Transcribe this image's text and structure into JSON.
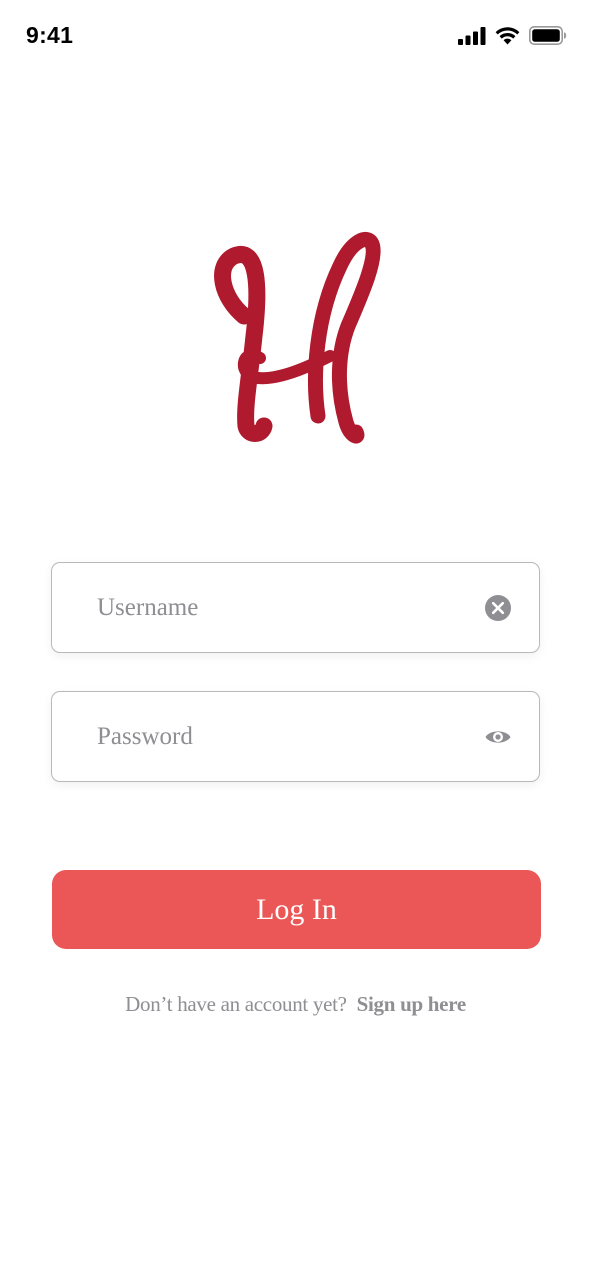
{
  "status_bar": {
    "time": "9:41",
    "icons": [
      "signal-icon",
      "wifi-icon",
      "battery-icon"
    ]
  },
  "logo": {
    "letter": "H",
    "color": "#b01a2e"
  },
  "form": {
    "username": {
      "placeholder": "Username",
      "value": "",
      "icon": "clear-icon"
    },
    "password": {
      "placeholder": "Password",
      "value": "",
      "icon": "eye-icon"
    },
    "login_label": "Log In"
  },
  "signup": {
    "prompt": "Don’t have an account yet?",
    "link_label": "Sign up here"
  },
  "colors": {
    "accent": "#eb5757",
    "logo": "#b01a2e",
    "muted_text": "#8e8e93",
    "field_border": "#b8b8bd"
  }
}
